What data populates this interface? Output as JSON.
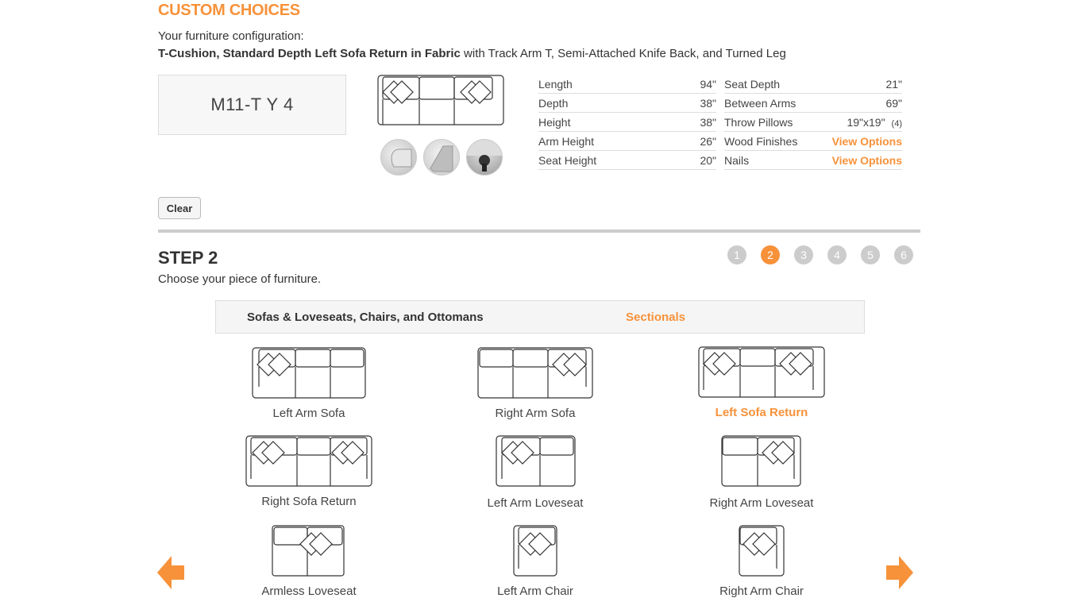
{
  "header": {
    "title": "CUSTOM CHOICES",
    "subtitle": "Your furniture configuration:",
    "config_bold": "T-Cushion, Standard Depth Left Sofa Return in Fabric",
    "config_rest": " with Track Arm T, Semi-Attached Knife Back, and Turned Leg"
  },
  "model_code": "M11-T Y 4",
  "thumbnails": [
    {
      "icon": "track-arm-thumbnail"
    },
    {
      "icon": "knife-back-thumbnail"
    },
    {
      "icon": "turned-leg-thumbnail"
    }
  ],
  "specs_left": [
    {
      "label": "Length",
      "value": "94\""
    },
    {
      "label": "Depth",
      "value": "38\""
    },
    {
      "label": "Height",
      "value": "38\""
    },
    {
      "label": "Arm Height",
      "value": "26\""
    },
    {
      "label": "Seat Height",
      "value": "20\""
    }
  ],
  "specs_right": [
    {
      "label": "Seat Depth",
      "value": "21\""
    },
    {
      "label": "Between Arms",
      "value": "69\""
    },
    {
      "label": "Throw Pillows",
      "value": "19\"x19\"",
      "extra": "(4)"
    },
    {
      "label": "Wood Finishes",
      "value": "View Options",
      "link": true
    },
    {
      "label": "Nails",
      "value": "View Options",
      "link": true
    }
  ],
  "clear_label": "Clear",
  "step": {
    "title": "STEP 2",
    "description": "Choose your piece of furniture.",
    "numbers": [
      "1",
      "2",
      "3",
      "4",
      "5",
      "6"
    ],
    "active": "2"
  },
  "tabs": [
    {
      "label": "Sofas & Loveseats, Chairs, and Ottomans",
      "active": false
    },
    {
      "label": "Sectionals",
      "active": true
    }
  ],
  "items": [
    {
      "label": "Left Arm Sofa",
      "selected": false
    },
    {
      "label": "Right Arm Sofa",
      "selected": false
    },
    {
      "label": "Left Sofa Return",
      "selected": true
    },
    {
      "label": "Right Sofa Return",
      "selected": false
    },
    {
      "label": "Left Arm Loveseat",
      "selected": false
    },
    {
      "label": "Right Arm Loveseat",
      "selected": false
    },
    {
      "label": "Armless Loveseat",
      "selected": false
    },
    {
      "label": "Left Arm Chair",
      "selected": false
    },
    {
      "label": "Right Arm Chair",
      "selected": false
    }
  ],
  "colors": {
    "accent": "#f7923a",
    "divider": "#cccccc",
    "step_inactive": "#cccccc"
  }
}
